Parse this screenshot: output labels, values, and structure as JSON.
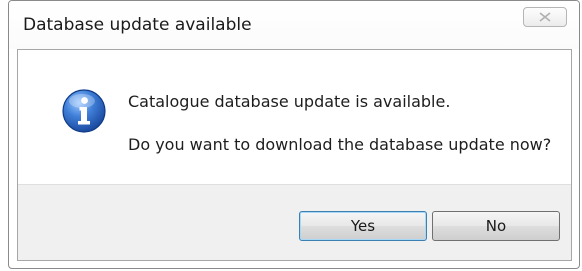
{
  "window": {
    "title": "Database update available",
    "close_icon": "close-x-icon"
  },
  "message": {
    "icon": "information-icon",
    "line1": "Catalogue database update is available.",
    "line2": "Do you want to download the database update now?"
  },
  "buttons": {
    "yes_label": "Yes",
    "no_label": "No"
  },
  "colors": {
    "icon_blue": "#1f5fb8",
    "default_button_border": "#3c7fb1",
    "footer_background": "#f0f0f0"
  }
}
